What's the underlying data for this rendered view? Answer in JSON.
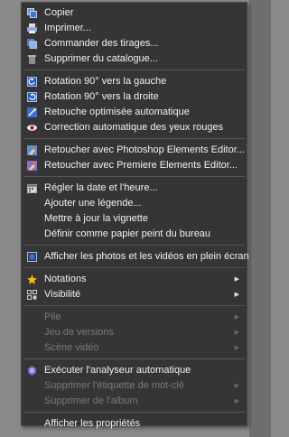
{
  "menu": {
    "group1": [
      {
        "label": "Copier",
        "icon": "copy-icon"
      },
      {
        "label": "Imprimer...",
        "icon": "print-icon"
      },
      {
        "label": "Commander des tirages...",
        "icon": "order-prints-icon"
      },
      {
        "label": "Supprimer du catalogue...",
        "icon": "trash-icon"
      }
    ],
    "group2": [
      {
        "label": "Rotation 90° vers la gauche",
        "icon": "rotate-left-icon"
      },
      {
        "label": "Rotation 90° vers la droite",
        "icon": "rotate-right-icon"
      },
      {
        "label": "Retouche optimisée automatique",
        "icon": "auto-fix-icon"
      },
      {
        "label": "Correction automatique des yeux rouges",
        "icon": "red-eye-icon"
      }
    ],
    "group3": [
      {
        "label": "Retoucher avec Photoshop Elements Editor...",
        "icon": "photoshop-editor-icon"
      },
      {
        "label": "Retoucher avec Premiere Elements Editor...",
        "icon": "premiere-editor-icon"
      }
    ],
    "group4": [
      {
        "label": "Régler la date et l'heure...",
        "icon": "calendar-icon"
      },
      {
        "label": "Ajouter une légende..."
      },
      {
        "label": "Mettre à jour la vignette"
      },
      {
        "label": "Définir comme papier peint du bureau"
      }
    ],
    "group5": [
      {
        "label": "Afficher les photos et les vidéos en plein écran",
        "icon": "fullscreen-icon"
      }
    ],
    "group6": [
      {
        "label": "Notations",
        "icon": "star-icon",
        "submenu": true
      },
      {
        "label": "Visibilité",
        "icon": "visibility-icon",
        "submenu": true
      }
    ],
    "group7": [
      {
        "label": "Pile",
        "disabled": true,
        "submenu": true
      },
      {
        "label": "Jeu de versions",
        "disabled": true,
        "submenu": true
      },
      {
        "label": "Scène vidéo",
        "disabled": true,
        "submenu": true
      }
    ],
    "group8": [
      {
        "label": "Exécuter l'analyseur automatique",
        "icon": "auto-analyzer-icon"
      },
      {
        "label": "Supprimer l'étiquette de mot-clé",
        "disabled": true,
        "submenu": true
      },
      {
        "label": "Supprimer de l'album",
        "disabled": true,
        "submenu": true
      }
    ],
    "group9": [
      {
        "label": "Afficher les propriétés"
      }
    ]
  }
}
